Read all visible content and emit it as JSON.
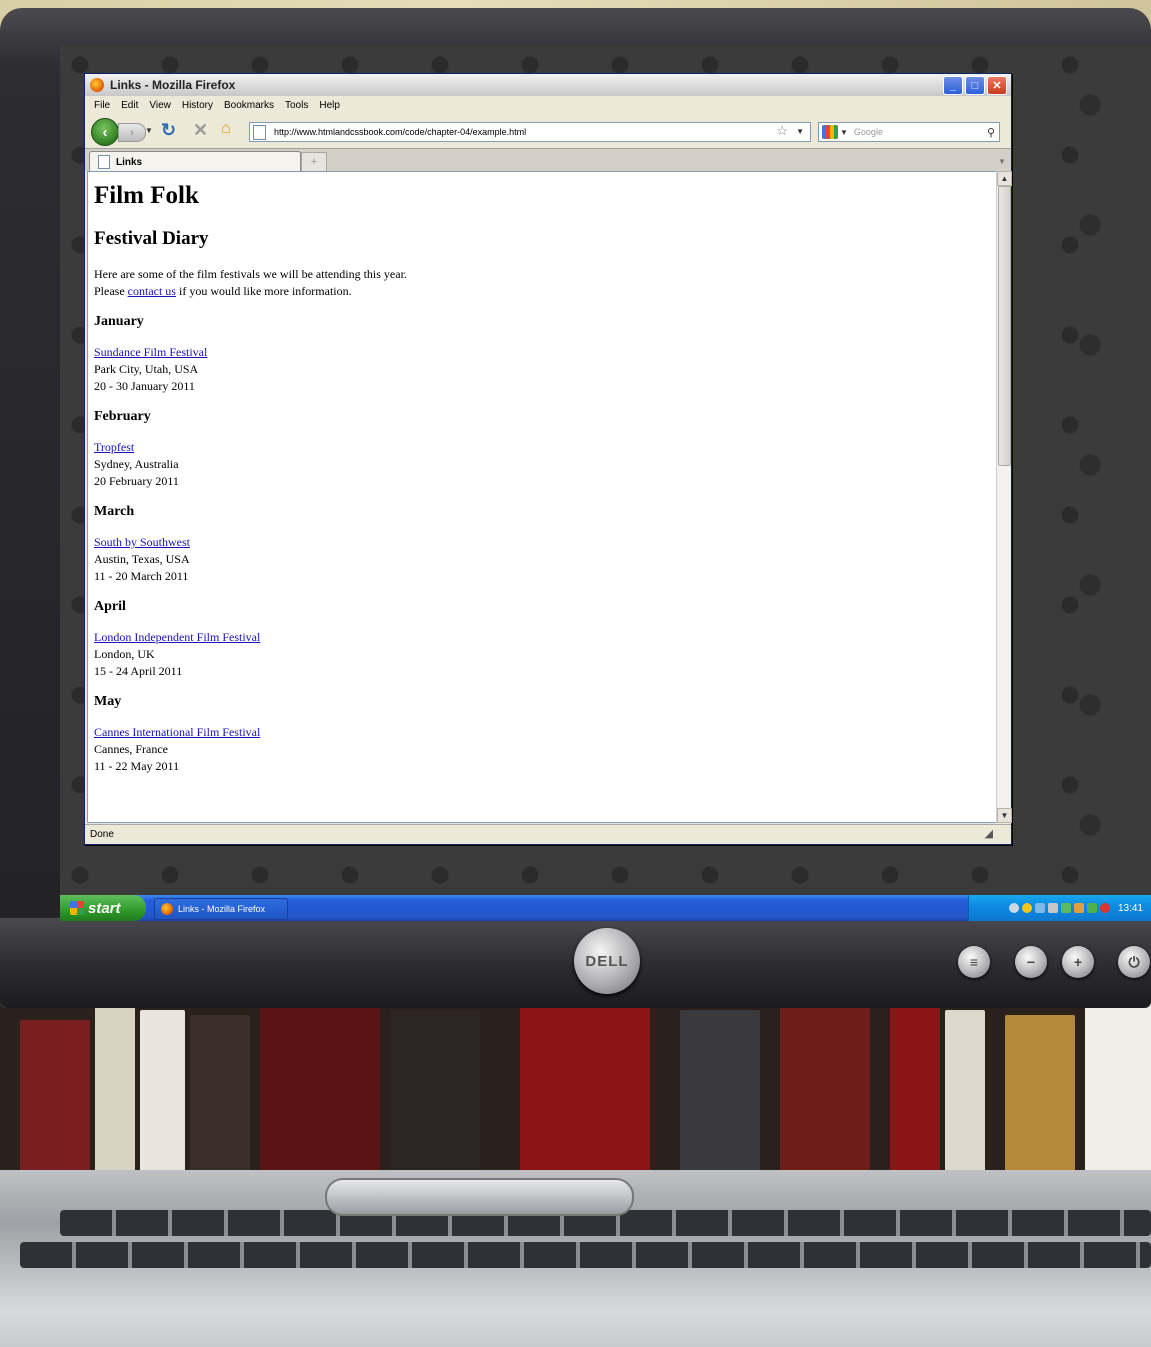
{
  "window": {
    "title": "Links - Mozilla Firefox",
    "menu": [
      "File",
      "Edit",
      "View",
      "History",
      "Bookmarks",
      "Tools",
      "Help"
    ],
    "url": "http://www.htmlandcssbook.com/code/chapter-04/example.html",
    "search_placeholder": "Google",
    "tab_label": "Links",
    "status": "Done"
  },
  "page": {
    "h1": "Film Folk",
    "h2": "Festival Diary",
    "intro_line1": "Here are some of the film festivals we will be attending this year.",
    "intro_prefix": "Please ",
    "intro_link": "contact us",
    "intro_suffix": " if you would like more information.",
    "months": [
      {
        "month": "January",
        "festival": "Sundance Film Festival",
        "location": "Park City, Utah, USA",
        "dates": "20 - 30 January 2011"
      },
      {
        "month": "February",
        "festival": "Tropfest",
        "location": "Sydney, Australia",
        "dates": "20 February 2011"
      },
      {
        "month": "March",
        "festival": "South by Southwest",
        "location": "Austin, Texas, USA",
        "dates": "11 - 20 March 2011"
      },
      {
        "month": "April",
        "festival": "London Independent Film Festival",
        "location": "London, UK",
        "dates": "15 - 24 April 2011"
      },
      {
        "month": "May",
        "festival": "Cannes International Film Festival",
        "location": "Cannes, France",
        "dates": "11 - 22 May 2011"
      }
    ]
  },
  "taskbar": {
    "start": "start",
    "task_label": "Links - Mozilla Firefox",
    "clock": "13:41"
  },
  "hardware": {
    "brand": "DELL"
  },
  "icons": {
    "back": "back-arrow-icon",
    "forward": "forward-arrow-icon",
    "reload": "reload-icon",
    "stop": "stop-icon",
    "home": "home-icon",
    "bookmark": "star-icon",
    "search": "magnifier-icon"
  }
}
